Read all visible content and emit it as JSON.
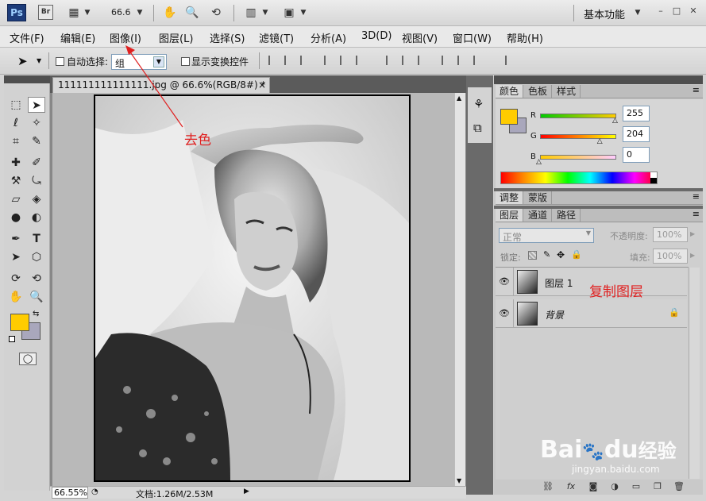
{
  "appbar": {
    "ps_logo": "Ps",
    "br_logo": "Br",
    "zoom": "66.6",
    "workspace": "基本功能",
    "icons": [
      "view-extras-icon",
      "hand-icon",
      "zoom-icon",
      "rotate-view-icon",
      "arrange-docs-icon",
      "screen-mode-icon"
    ]
  },
  "menu": [
    "文件(F)",
    "编辑(E)",
    "图像(I)",
    "图层(L)",
    "选择(S)",
    "滤镜(T)",
    "分析(A)",
    "3D(D)",
    "视图(V)",
    "窗口(W)",
    "帮助(H)"
  ],
  "options": {
    "auto_select_label": "自动选择:",
    "auto_select_value": "组",
    "transform_label": "显示变换控件"
  },
  "document": {
    "tab_title": "111111111111111.jpg @ 66.6%(RGB/8#) *",
    "close": "×",
    "zoom_status": "66.55%",
    "doc_status": "文档:1.26M/2.53M"
  },
  "color_panel": {
    "tabs": [
      "颜色",
      "色板",
      "样式"
    ],
    "r_label": "R",
    "g_label": "G",
    "b_label": "B",
    "r": "255",
    "g": "204",
    "b": "0",
    "r_frac": 1.0,
    "g_frac": 0.8,
    "b_frac": 0.0,
    "fg_color": "#ffcc00",
    "bg_color": "#a9a7bc"
  },
  "adjust_tabs": [
    "调整",
    "蒙版"
  ],
  "layers_panel": {
    "tabs": [
      "图层",
      "通道",
      "路径"
    ],
    "blend_mode": "正常",
    "opacity_label": "不透明度:",
    "opacity_value": "100%",
    "lock_label": "锁定:",
    "fill_label": "填充:",
    "fill_value": "100%",
    "layers": [
      {
        "name": "图层 1",
        "locked": false
      },
      {
        "name": "背景",
        "locked": true
      }
    ]
  },
  "annotations": {
    "decolor": "去色",
    "duplicate_layer": "复制图层"
  },
  "watermark": {
    "brand": "Bai",
    "du": "du",
    "suffix": "经验",
    "url": "jingyan.baidu.com"
  }
}
